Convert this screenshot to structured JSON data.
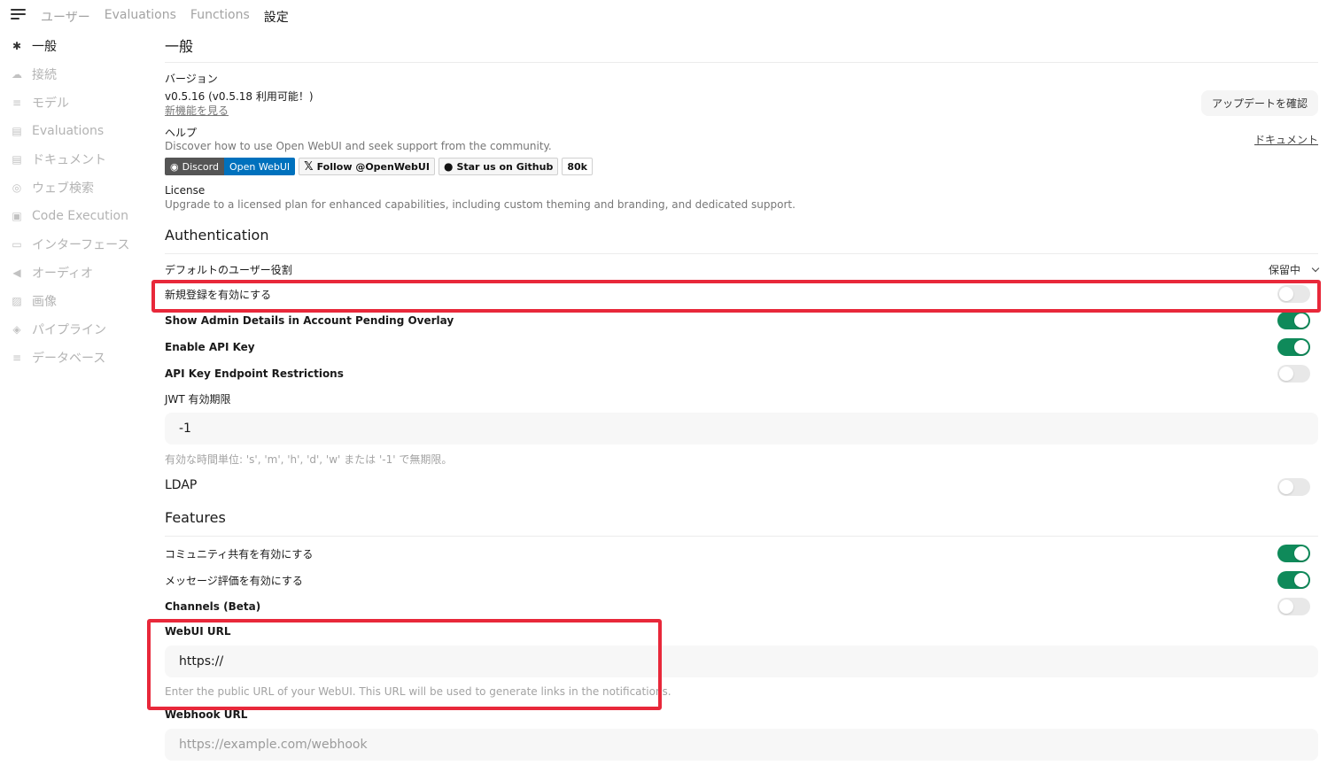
{
  "nav": {
    "tabs": [
      "ユーザー",
      "Evaluations",
      "Functions",
      "設定"
    ],
    "active_tab": "設定"
  },
  "sidebar": {
    "items": [
      {
        "label": "一般",
        "icon": "gear-icon"
      },
      {
        "label": "接続",
        "icon": "cloud-icon"
      },
      {
        "label": "モデル",
        "icon": "database-icon"
      },
      {
        "label": "Evaluations",
        "icon": "document-icon"
      },
      {
        "label": "ドキュメント",
        "icon": "document-icon"
      },
      {
        "label": "ウェブ検索",
        "icon": "globe-icon"
      },
      {
        "label": "Code Execution",
        "icon": "terminal-icon"
      },
      {
        "label": "インターフェース",
        "icon": "monitor-icon"
      },
      {
        "label": "オーディオ",
        "icon": "speaker-icon"
      },
      {
        "label": "画像",
        "icon": "image-icon"
      },
      {
        "label": "パイプライン",
        "icon": "layers-icon"
      },
      {
        "label": "データベース",
        "icon": "database-icon"
      }
    ]
  },
  "general": {
    "title": "一般",
    "version_label": "バージョン",
    "version_value": "v0.5.16 (v0.5.18 利用可能！)",
    "whats_new": "新機能を見る",
    "check_update": "アップデートを確認",
    "help_label": "ヘルプ",
    "help_text": "Discover how to use Open WebUI and seek support from the community.",
    "docs_link": "ドキュメント",
    "badges": {
      "discord_a": "Discord",
      "discord_b": "Open WebUI",
      "twitter": "Follow @OpenWebUI",
      "github": "Star us on Github",
      "stars": "80k"
    },
    "license_label": "License",
    "license_text": "Upgrade to a licensed plan for enhanced capabilities, including custom theming and branding, and dedicated support."
  },
  "auth": {
    "title": "Authentication",
    "default_role_label": "デフォルトのユーザー役割",
    "default_role_value": "保留中",
    "signup_label": "新規登録を有効にする",
    "admin_details_label": "Show Admin Details in Account Pending Overlay",
    "api_key_label": "Enable API Key",
    "api_restrict_label": "API Key Endpoint Restrictions",
    "jwt_label": "JWT 有効期限",
    "jwt_value": "-1",
    "jwt_help": "有効な時間単位: 's', 'm', 'h', 'd', 'w' または '-1' で無期限。",
    "ldap_label": "LDAP"
  },
  "features": {
    "title": "Features",
    "community_label": "コミュニティ共有を有効にする",
    "rating_label": "メッセージ評価を有効にする",
    "channels_label": "Channels (Beta)",
    "webui_url_label": "WebUI URL",
    "webui_url_value": "https://",
    "webui_url_help": "Enter the public URL of your WebUI. This URL will be used to generate links in the notifications.",
    "webhook_label": "Webhook URL",
    "webhook_placeholder": "https://example.com/webhook"
  },
  "toggles": {
    "signup": false,
    "admin_details": true,
    "api_key": true,
    "api_restrict": false,
    "ldap": false,
    "community": true,
    "rating": true,
    "channels": false
  },
  "colors": {
    "toggle_on": "#0f8a5a",
    "highlight": "#e8283a",
    "discord_blue": "#0071bd"
  }
}
